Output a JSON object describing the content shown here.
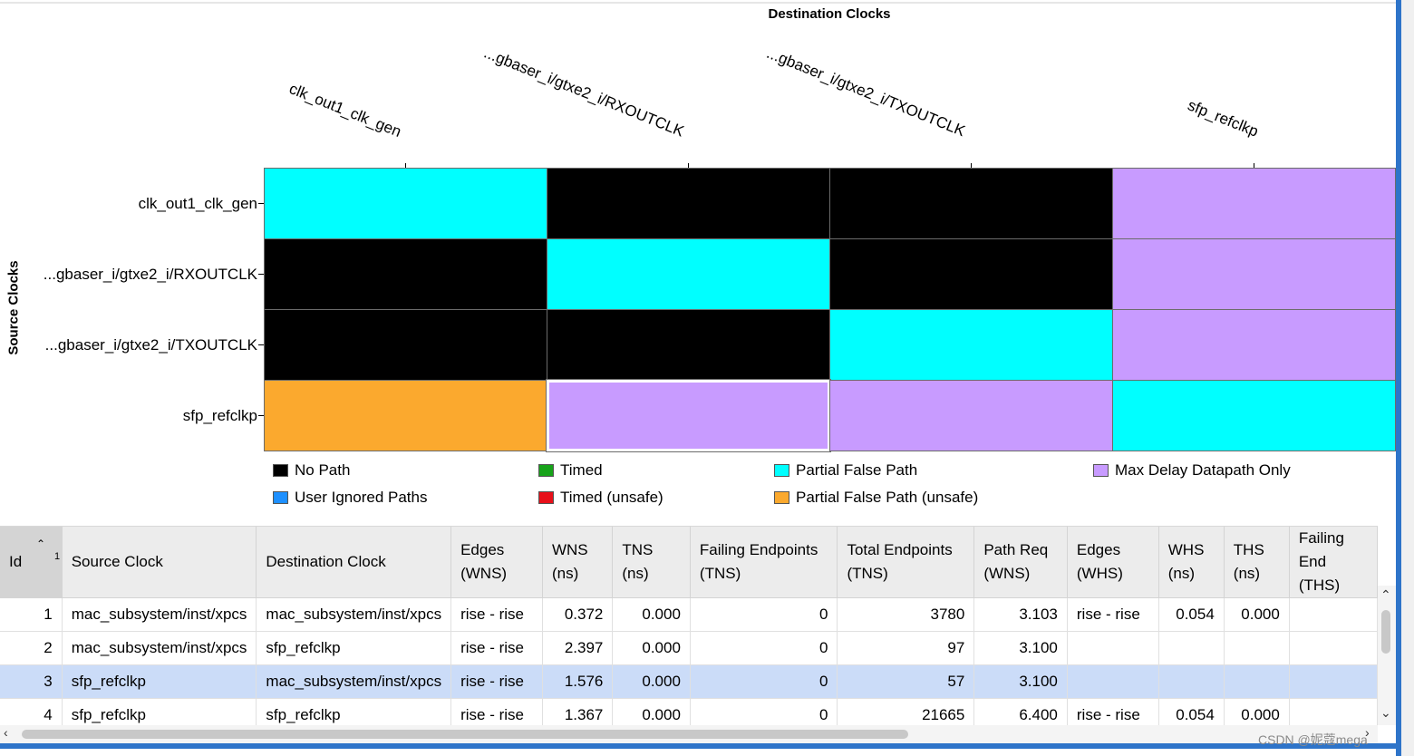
{
  "matrix": {
    "title": "Destination Clocks",
    "source_axis_title": "Source Clocks",
    "columns": [
      "clk_out1_clk_gen",
      "...gbaser_i/gtxe2_i/RXOUTCLK",
      "...gbaser_i/gtxe2_i/TXOUTCLK",
      "sfp_refclkp"
    ],
    "rows": [
      "clk_out1_clk_gen",
      "...gbaser_i/gtxe2_i/RXOUTCLK",
      "...gbaser_i/gtxe2_i/TXOUTCLK",
      "sfp_refclkp"
    ],
    "cells": [
      [
        "Partial False Path",
        "No Path",
        "No Path",
        "Max Delay Datapath Only"
      ],
      [
        "No Path",
        "Partial False Path",
        "No Path",
        "Max Delay Datapath Only"
      ],
      [
        "No Path",
        "No Path",
        "Partial False Path",
        "Max Delay Datapath Only"
      ],
      [
        "Partial False Path (unsafe)",
        "Max Delay Datapath Only",
        "Max Delay Datapath Only",
        "Partial False Path"
      ]
    ],
    "selected_cell": {
      "row": 3,
      "col": 1
    }
  },
  "legend": [
    {
      "label": "No Path",
      "color": "#000000"
    },
    {
      "label": "Timed",
      "color": "#17a31a"
    },
    {
      "label": "Partial False Path",
      "color": "#00ffff"
    },
    {
      "label": "Max Delay Datapath Only",
      "color": "#c89bff"
    },
    {
      "label": "User Ignored Paths",
      "color": "#1e90ff"
    },
    {
      "label": "Timed (unsafe)",
      "color": "#e8101a"
    },
    {
      "label": "Partial False Path (unsafe)",
      "color": "#fba92e"
    }
  ],
  "table": {
    "headers": [
      "Id",
      "Source Clock",
      "Destination Clock",
      "Edges\n(WNS)",
      "WNS\n(ns)",
      "TNS\n(ns)",
      "Failing Endpoints\n(TNS)",
      "Total Endpoints\n(TNS)",
      "Path Req\n(WNS)",
      "Edges\n(WHS)",
      "WHS\n(ns)",
      "THS\n(ns)",
      "Failing End\n(THS)"
    ],
    "sort_index": "1",
    "selected_row": 2,
    "rows": [
      [
        "1",
        "mac_subsystem/inst/xpcs",
        "mac_subsystem/inst/xpcs",
        "rise - rise",
        "0.372",
        "0.000",
        "0",
        "3780",
        "3.103",
        "rise - rise",
        "0.054",
        "0.000",
        ""
      ],
      [
        "2",
        "mac_subsystem/inst/xpcs",
        "sfp_refclkp",
        "rise - rise",
        "2.397",
        "0.000",
        "0",
        "97",
        "3.100",
        "",
        "",
        "",
        ""
      ],
      [
        "3",
        "sfp_refclkp",
        "mac_subsystem/inst/xpcs",
        "rise - rise",
        "1.576",
        "0.000",
        "0",
        "57",
        "3.100",
        "",
        "",
        "",
        ""
      ],
      [
        "4",
        "sfp_refclkp",
        "sfp_refclkp",
        "rise - rise",
        "1.367",
        "0.000",
        "0",
        "21665",
        "6.400",
        "rise - rise",
        "0.054",
        "0.000",
        ""
      ]
    ]
  },
  "watermark": "CSDN @妮蔻mega"
}
